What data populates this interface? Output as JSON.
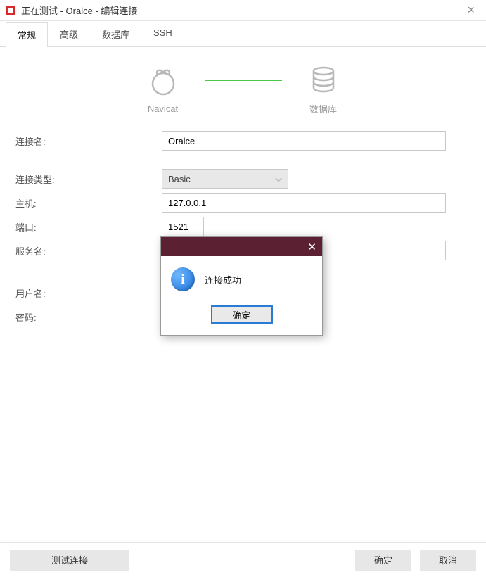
{
  "window": {
    "title": "正在测试 - Oralce - 编辑连接"
  },
  "tabs": {
    "general": "常规",
    "advanced": "高级",
    "database": "数据库",
    "ssh": "SSH"
  },
  "visual": {
    "navicat_label": "Navicat",
    "db_label": "数据库"
  },
  "form": {
    "conn_name_label": "连接名:",
    "conn_name_value": "Oralce",
    "conn_type_label": "连接类型:",
    "conn_type_value": "Basic",
    "host_label": "主机:",
    "host_value": "127.0.0.1",
    "port_label": "端口:",
    "port_value": "1521",
    "service_label": "服务名:",
    "service_value": "",
    "user_label": "用户名:",
    "user_value": "",
    "password_label": "密码:",
    "password_value": ""
  },
  "footer": {
    "test_label": "测试连接",
    "ok_label": "确定",
    "cancel_label": "取消"
  },
  "modal": {
    "message": "连接成功",
    "ok_label": "确定"
  }
}
